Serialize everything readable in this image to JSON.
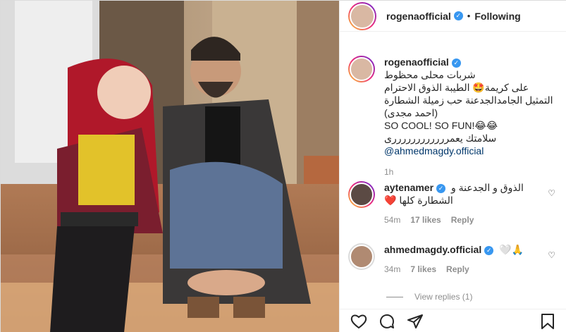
{
  "post": {
    "author": "rogenaofficial",
    "follow_state": "Following",
    "separator": "•"
  },
  "caption": {
    "username": "rogenaofficial",
    "lines": [
      "شربات محلى محظوط",
      "على كريمة🤩 الطيبة الذوق الاحترام",
      "التمثيل الجامدالجدعنة حب زميلة الشطارة",
      "(احمد مجدى)",
      "SO COOL! SO FUN!😂😂",
      "سلامتك يعمررررررررررررى"
    ],
    "mention": "@ahmedmagdy.official",
    "time": "1h"
  },
  "comments": [
    {
      "username": "aytenamer",
      "lines": [
        "الذوق و الجدعنة و",
        "الشطارة كلها ❤️"
      ],
      "time": "54m",
      "likes": "17 likes",
      "reply": "Reply"
    },
    {
      "username": "ahmedmagdy.official",
      "lines": [
        "🤍🙏"
      ],
      "time": "34m",
      "likes": "7 likes",
      "reply": "Reply"
    }
  ],
  "view_replies": "View replies (1)",
  "icons": {
    "like": "heart-icon",
    "comment": "comment-icon",
    "share": "share-icon",
    "save": "bookmark-icon",
    "verified": "verified-icon"
  },
  "colors": {
    "verified": "#3897f0",
    "mention": "#00376b",
    "meta": "#8e8e8e",
    "heart_red": "#ed4956"
  }
}
